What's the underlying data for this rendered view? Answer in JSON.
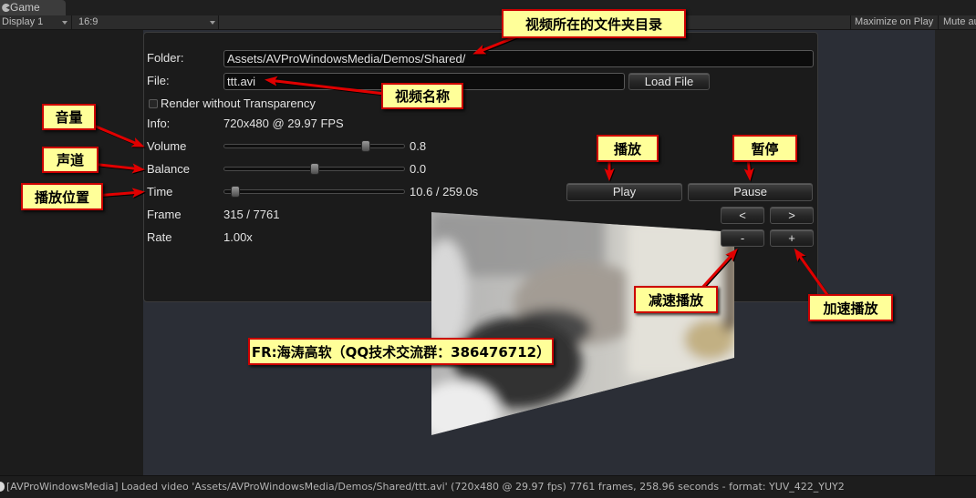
{
  "editor": {
    "tab": {
      "label": "Game",
      "icon": "game-controller-icon"
    },
    "toolbar": {
      "display": "Display 1",
      "aspect": "16:9",
      "maximize_on_play": "Maximize on Play",
      "mute_audio": "Mute au"
    }
  },
  "player": {
    "folder": {
      "label": "Folder:",
      "value": "Assets/AVProWindowsMedia/Demos/Shared/"
    },
    "file": {
      "label": "File:",
      "value": "ttt.avi",
      "load_button": "Load File"
    },
    "render_without_transparency": {
      "label": "Render without Transparency",
      "checked": false
    },
    "info": {
      "label": "Info:",
      "value": "720x480 @ 29.97 FPS"
    },
    "volume": {
      "label": "Volume",
      "value": "0.8",
      "slider_fraction": 0.8
    },
    "balance": {
      "label": "Balance",
      "value": "0.0",
      "slider_fraction": 0.5
    },
    "time": {
      "label": "Time",
      "value": "10.6 / 259.0s",
      "slider_fraction": 0.041
    },
    "frame": {
      "label": "Frame",
      "value": "315 / 7761"
    },
    "rate": {
      "label": "Rate",
      "value": "1.00x"
    },
    "buttons": {
      "play": "Play",
      "pause": "Pause",
      "step_back": "<",
      "step_forward": ">",
      "rate_down": "-",
      "rate_up": "+"
    }
  },
  "annotations": {
    "folder": "视频所在的文件夹目录",
    "file_name": "视频名称",
    "volume": "音量",
    "balance": "声道",
    "position": "播放位置",
    "play": "播放",
    "pause": "暂停",
    "slow_down": "减速播放",
    "speed_up": "加速播放",
    "credit": "FR:海涛高软（QQ技术交流群：386476712）"
  },
  "console": {
    "icon": "info-icon",
    "message": "[AVProWindowsMedia] Loaded video 'Assets/AVProWindowsMedia/Demos/Shared/ttt.avi' (720x480 @ 29.97 fps) 7761 frames, 258.96 seconds - format: YUV_422_YUY2"
  },
  "colors": {
    "annotation_fill": "#ffff99",
    "annotation_border": "#cc0000",
    "annotation_arrow": "#e00000",
    "game_view_background": "#2b2e36"
  }
}
